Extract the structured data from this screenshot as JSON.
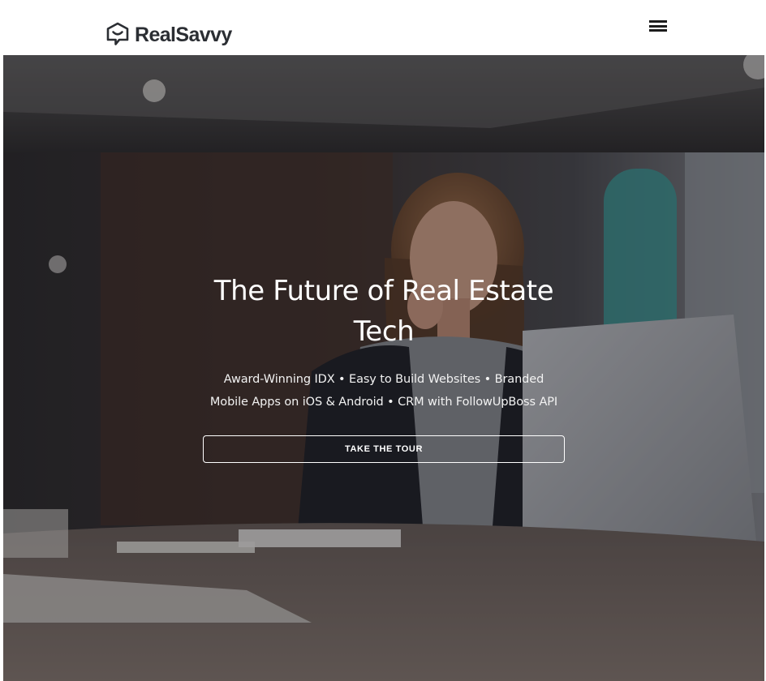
{
  "header": {
    "logo_text": "RealSavvy",
    "logo_icon": "house-smile-icon",
    "menu_icon": "hamburger-menu-icon"
  },
  "hero": {
    "title": "The Future of Real Estate Tech",
    "subtitle": "Award-Winning IDX • Easy to Build Websites • Branded Mobile Apps on iOS & Android • CRM with FollowUpBoss API",
    "cta_label": "TAKE THE TOUR",
    "background": "photo-woman-at-laptop"
  },
  "colors": {
    "header_bg": "#ffffff",
    "logo": "#2b2e33",
    "hero_text": "#ffffff",
    "overlay": "rgba(20,22,28,0.38)"
  }
}
